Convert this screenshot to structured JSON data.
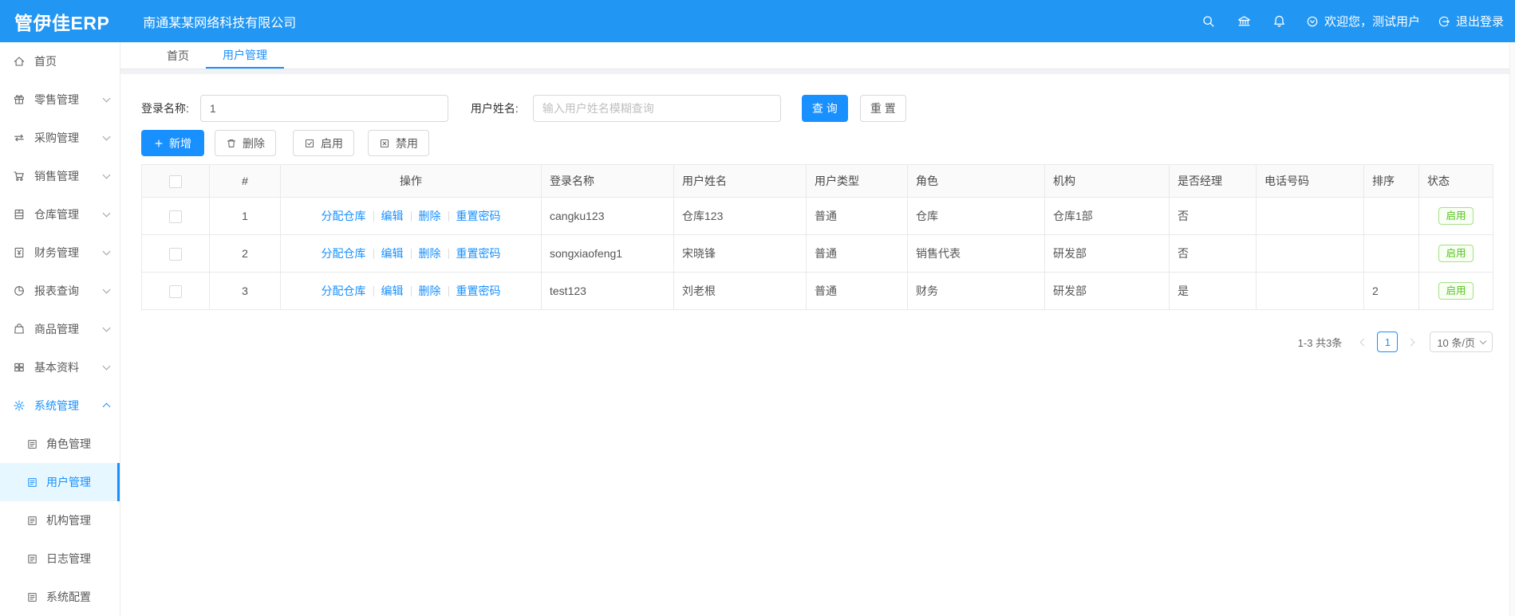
{
  "header": {
    "logo": "管伊佳ERP",
    "company": "南通某某网络科技有限公司",
    "welcome": "欢迎您，测试用户",
    "logout": "退出登录",
    "icons": [
      "search-icon",
      "bank-icon",
      "bell-icon",
      "user-dropdown-icon",
      "logout-icon"
    ],
    "bar_color": "#2196f3"
  },
  "sidebar": {
    "items": [
      {
        "label": "首页",
        "icon": "home-icon"
      },
      {
        "label": "零售管理",
        "icon": "retail-icon"
      },
      {
        "label": "采购管理",
        "icon": "purchase-icon"
      },
      {
        "label": "销售管理",
        "icon": "cart-icon"
      },
      {
        "label": "仓库管理",
        "icon": "warehouse-icon"
      },
      {
        "label": "财务管理",
        "icon": "finance-icon"
      },
      {
        "label": "报表查询",
        "icon": "pie-chart-icon"
      },
      {
        "label": "商品管理",
        "icon": "goods-icon"
      },
      {
        "label": "基本资料",
        "icon": "grid-icon"
      },
      {
        "label": "系统管理",
        "icon": "gear-icon",
        "active": true,
        "expanded": true
      }
    ],
    "subitems": [
      {
        "label": "角色管理"
      },
      {
        "label": "用户管理",
        "active": true
      },
      {
        "label": "机构管理"
      },
      {
        "label": "日志管理"
      },
      {
        "label": "系统配置"
      }
    ]
  },
  "tabs": [
    {
      "label": "首页"
    },
    {
      "label": "用户管理",
      "active": true
    }
  ],
  "search": {
    "login_label": "登录名称:",
    "login_value": "1",
    "name_label": "用户姓名:",
    "name_placeholder": "输入用户姓名模糊查询",
    "query_label": "查 询",
    "reset_label": "重 置"
  },
  "toolbar": {
    "add_label": "新增",
    "delete_label": "删除",
    "enable_label": "启用",
    "disable_label": "禁用"
  },
  "table": {
    "headers": [
      "#",
      "操作",
      "登录名称",
      "用户姓名",
      "用户类型",
      "角色",
      "机构",
      "是否经理",
      "电话号码",
      "排序",
      "状态"
    ],
    "action_links": [
      "分配仓库",
      "编辑",
      "删除",
      "重置密码"
    ],
    "rows": [
      {
        "index": "1",
        "login": "cangku123",
        "name": "仓库123",
        "type": "普通",
        "role": "仓库",
        "org": "仓库1部",
        "manager": "否",
        "phone": "",
        "sort": "",
        "status": "启用"
      },
      {
        "index": "2",
        "login": "songxiaofeng1",
        "name": "宋晓锋",
        "type": "普通",
        "role": "销售代表",
        "org": "研发部",
        "manager": "否",
        "phone": "",
        "sort": "",
        "status": "启用"
      },
      {
        "index": "3",
        "login": "test123",
        "name": "刘老根",
        "type": "普通",
        "role": "财务",
        "org": "研发部",
        "manager": "是",
        "phone": "",
        "sort": "2",
        "status": "启用"
      }
    ]
  },
  "pagination": {
    "total_text": "1-3 共3条",
    "current_page": "1",
    "page_size": "10 条/页"
  },
  "colors": {
    "primary": "#1890ff",
    "header_bar": "#2196f3",
    "status_green": "#52c41a",
    "active_menu_bg": "#e6f7ff"
  }
}
